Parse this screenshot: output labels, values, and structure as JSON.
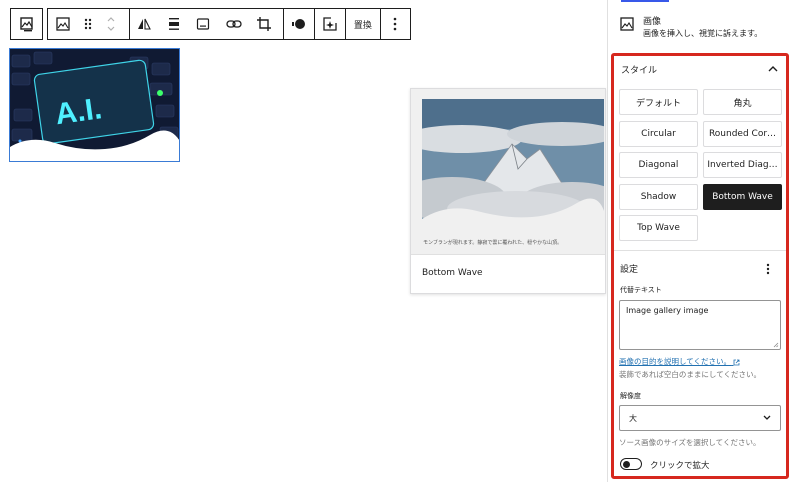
{
  "toolbar": {
    "replace_label": "置換"
  },
  "block_card": {
    "title": "画像",
    "description": "画像を挿入し、視覚に訴えます。"
  },
  "styles_panel": {
    "title": "スタイル",
    "options": [
      {
        "label": "デフォルト",
        "active": false
      },
      {
        "label": "角丸",
        "active": false
      },
      {
        "label": "Circular",
        "active": false
      },
      {
        "label": "Rounded Cor…",
        "active": false
      },
      {
        "label": "Diagonal",
        "active": false
      },
      {
        "label": "Inverted Diag…",
        "active": false
      },
      {
        "label": "Shadow",
        "active": false
      },
      {
        "label": "Bottom Wave",
        "active": true
      },
      {
        "label": "Top Wave",
        "active": false
      }
    ]
  },
  "settings_panel": {
    "title": "設定",
    "alt_label": "代替テキスト",
    "alt_value": "Image gallery image",
    "alt_help_link": "画像の目的を説明してください。",
    "alt_help_text": "装飾であれば空白のままにしてください。",
    "resolution_label": "解像度",
    "resolution_value": "大",
    "resolution_help": "ソース画像のサイズを選択してください。",
    "lightbox_label": "クリックで拡大"
  },
  "preview": {
    "caption": "モンブランが現れます。静寂で雲に覆われた、穏やかな山頂。",
    "style_name": "Bottom Wave"
  },
  "selected_image": {
    "text": "A.I."
  }
}
